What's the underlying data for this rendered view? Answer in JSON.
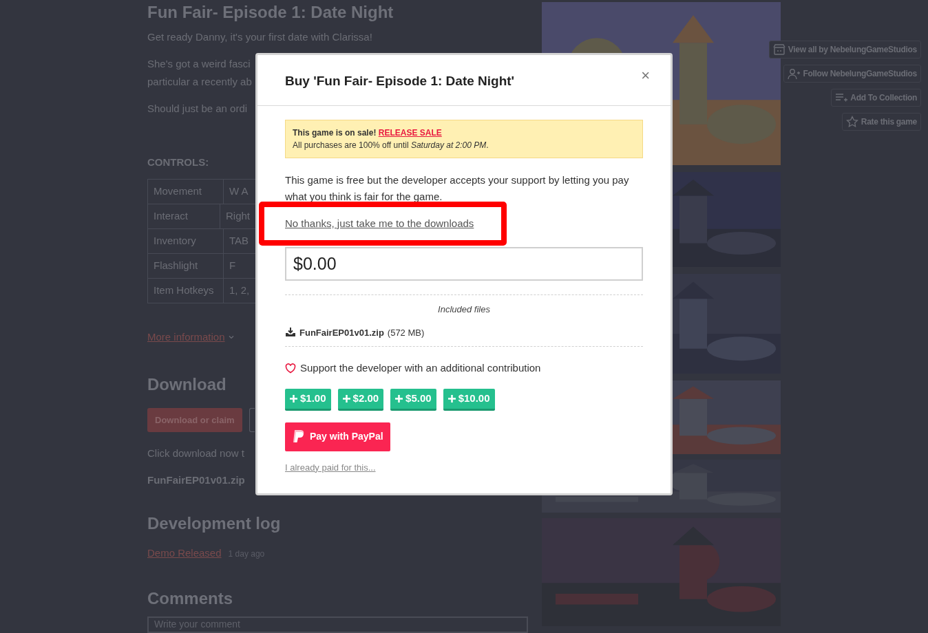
{
  "page": {
    "title": "Fun Fair- Episode 1: Date Night",
    "intro": "Get ready Danny, it's your first date with Clarissa!",
    "paragraph_lines": [
      "She's got a weird fasci",
      "particular a recently ab",
      "Should just be an ordi"
    ],
    "controls_heading": "CONTROLS:",
    "controls": [
      {
        "action": "Movement",
        "key": "W A"
      },
      {
        "action": "Interact",
        "key": "Right"
      },
      {
        "action": "Inventory",
        "key": "TAB"
      },
      {
        "action": "Flashlight",
        "key": "F"
      },
      {
        "action": "Item Hotkeys",
        "key": "1, 2,"
      }
    ],
    "more_info": "More information",
    "download_heading": "Download",
    "download_button": "Download or claim",
    "download_note": "Click download now t",
    "file_name": "FunFairEP01v01.zip",
    "devlog_heading": "Development log",
    "devlog": [
      {
        "title": "Demo Released",
        "time": "1 day ago"
      }
    ],
    "comments_heading": "Comments",
    "comment_placeholder": "Write your comment"
  },
  "side_buttons": [
    {
      "kind": "view_all",
      "label": "View all by NebelungGameStudios"
    },
    {
      "kind": "follow",
      "label": "Follow NebelungGameStudios"
    },
    {
      "kind": "collection",
      "label": "Add To Collection"
    },
    {
      "kind": "rate",
      "label": "Rate this game"
    }
  ],
  "modal": {
    "title": "Buy 'Fun Fair- Episode 1: Date Night'",
    "close": "×",
    "sale": {
      "text": "**This game is on sale!**",
      "link": "RELEASE SALE",
      "detail": "All purchases are 100% off until *Saturday at 2:00 PM*."
    },
    "description": "This game is free but the developer accepts your support by letting you pay what you think is fair for the game.",
    "skip_link": "No thanks, just take me to the downloads",
    "highlighted": true,
    "price": "$0.00",
    "files_heading": "Included files",
    "files": [
      {
        "name": "FunFairEP01v01.zip",
        "size": "(572 MB)"
      }
    ],
    "support_text": "Support the developer with an additional contribution",
    "tips": [
      "$1.00",
      "$2.00",
      "$5.00",
      "$10.00"
    ],
    "paypal": "Pay with PayPal",
    "already_paid": "I already paid for this..."
  }
}
